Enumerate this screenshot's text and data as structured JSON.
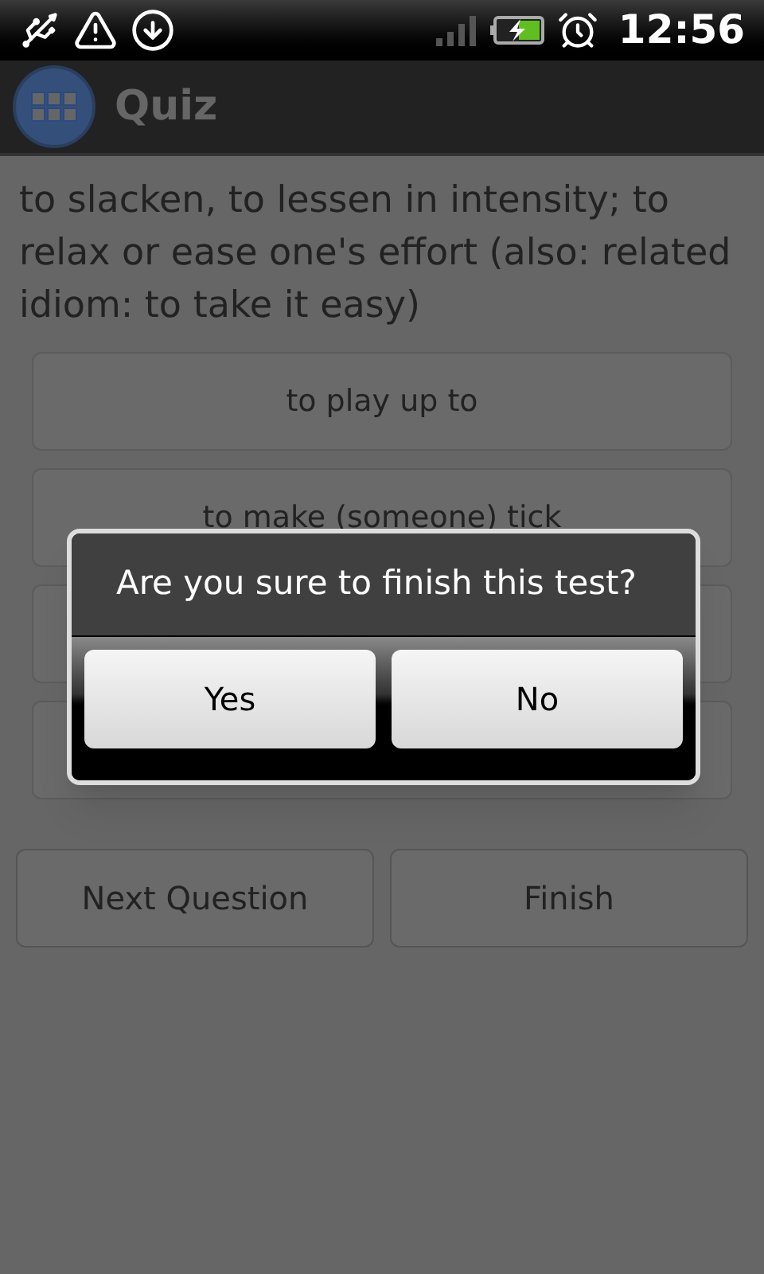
{
  "status_bar": {
    "time": "12:56"
  },
  "title_bar": {
    "title": "Quiz"
  },
  "question": "to slacken, to lessen in intensity; to relax or ease one's effort (also: related idiom: to take it easy)",
  "answers": [
    {
      "label": "to play up to"
    },
    {
      "label": "to make (someone) tick"
    }
  ],
  "bottom_buttons": [
    "Next Question",
    "Finish"
  ],
  "dialog": {
    "message": "Are you sure to finish this test?",
    "buttons": [
      "Yes",
      "No"
    ]
  }
}
